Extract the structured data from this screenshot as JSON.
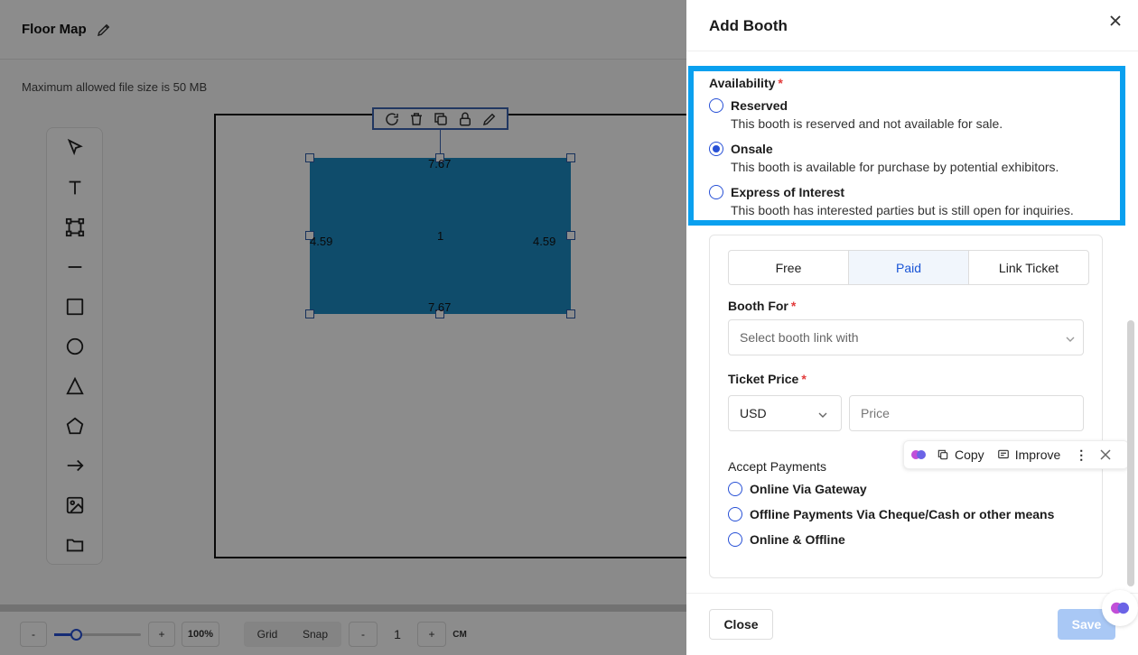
{
  "editor": {
    "title": "Floor Map",
    "hint": "Maximum allowed file size is 50 MB",
    "booth": {
      "label": "1",
      "width_top": "7.67",
      "width_bottom": "7.67",
      "height_left": "4.59",
      "height_right": "4.59",
      "color": "#1d8ac4"
    },
    "tools": [
      "cursor-icon",
      "text-icon",
      "transform-icon",
      "line-icon",
      "square-icon",
      "circle-icon",
      "triangle-icon",
      "pentagon-icon",
      "arrow-icon",
      "image-icon",
      "folder-icon"
    ],
    "bottom": {
      "minus": "-",
      "plus": "+",
      "zoom": "100%",
      "zoom_level": 0.25,
      "grid": "Grid",
      "snap": "Snap",
      "step_minus": "-",
      "step_value": "1",
      "step_plus": "+",
      "unit": "CM"
    }
  },
  "drawer": {
    "title": "Add Booth",
    "availability": {
      "label": "Availability",
      "required": "*",
      "options": [
        {
          "label": "Reserved",
          "desc": "This booth is reserved and not available for sale.",
          "checked": false
        },
        {
          "label": "Onsale",
          "desc": "This booth is available for purchase by potential exhibitors.",
          "checked": true
        },
        {
          "label": "Express of Interest",
          "desc": "This booth has interested parties but is still open for inquiries.",
          "checked": false
        }
      ]
    },
    "tabs": [
      {
        "label": "Free",
        "active": false
      },
      {
        "label": "Paid",
        "active": true
      },
      {
        "label": "Link Ticket",
        "active": false
      }
    ],
    "booth_for": {
      "label": "Booth For",
      "required": "*",
      "placeholder": "Select booth link with"
    },
    "ticket_price": {
      "label": "Ticket Price",
      "required": "*",
      "currency": "USD",
      "price_placeholder": "Price"
    },
    "ai_bar": {
      "copy": "Copy",
      "improve": "Improve"
    },
    "accept_payments": {
      "label": "Accept Payments",
      "options": [
        "Online Via Gateway",
        "Offline Payments Via Cheque/Cash or other means",
        "Online & Offline"
      ]
    },
    "footer": {
      "close": "Close",
      "save": "Save"
    }
  },
  "colors": {
    "accent": "#2750d6",
    "highlight": "#0aa0ef",
    "save_disabled": "#a9c8f5"
  }
}
